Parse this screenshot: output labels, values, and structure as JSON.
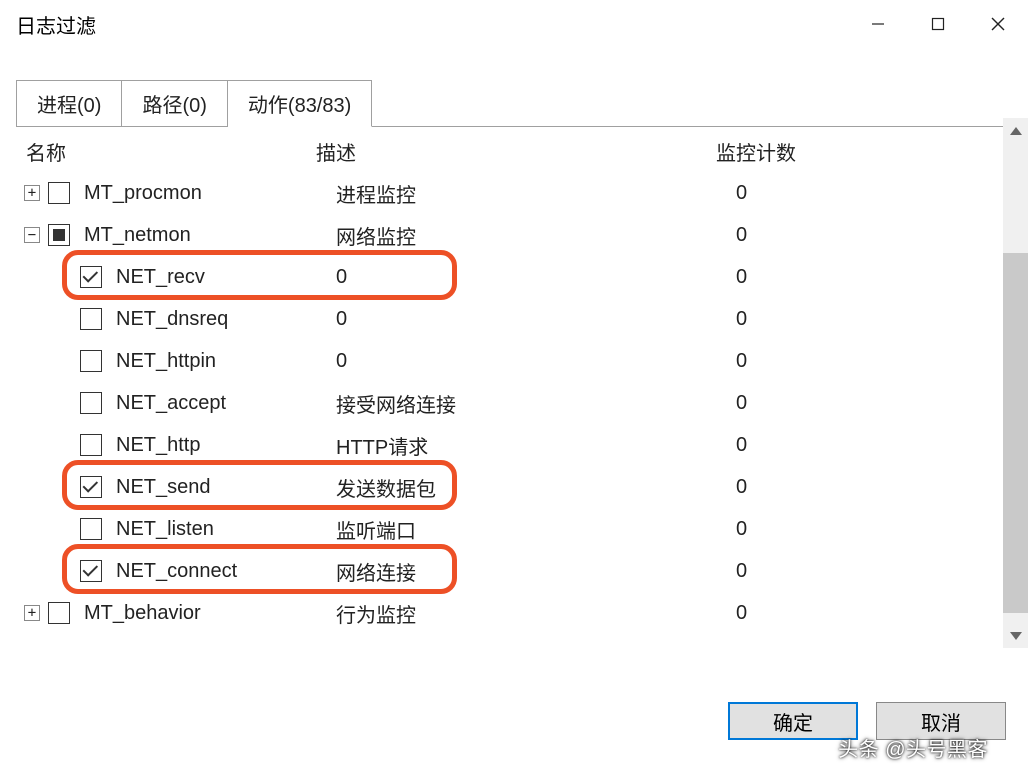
{
  "window": {
    "title": "日志过滤"
  },
  "tabs": [
    {
      "label": "进程(0)"
    },
    {
      "label": "路径(0)"
    },
    {
      "label": "动作(83/83)"
    }
  ],
  "columns": {
    "name": "名称",
    "desc": "描述",
    "count": "监控计数"
  },
  "tree": [
    {
      "indent": 0,
      "expand": "+",
      "check": "none",
      "name": "MT_procmon",
      "desc": "进程监控",
      "count": "0"
    },
    {
      "indent": 0,
      "expand": "-",
      "check": "partial",
      "name": "MT_netmon",
      "desc": "网络监控",
      "count": "0"
    },
    {
      "indent": 1,
      "expand": "",
      "check": "checked",
      "name": "NET_recv",
      "desc": "0",
      "count": "0",
      "highlight": true
    },
    {
      "indent": 1,
      "expand": "",
      "check": "none",
      "name": "NET_dnsreq",
      "desc": "0",
      "count": "0"
    },
    {
      "indent": 1,
      "expand": "",
      "check": "none",
      "name": "NET_httpin",
      "desc": "0",
      "count": "0"
    },
    {
      "indent": 1,
      "expand": "",
      "check": "none",
      "name": "NET_accept",
      "desc": "接受网络连接",
      "count": "0"
    },
    {
      "indent": 1,
      "expand": "",
      "check": "none",
      "name": "NET_http",
      "desc": "HTTP请求",
      "count": "0"
    },
    {
      "indent": 1,
      "expand": "",
      "check": "checked",
      "name": "NET_send",
      "desc": "发送数据包",
      "count": "0",
      "highlight": true
    },
    {
      "indent": 1,
      "expand": "",
      "check": "none",
      "name": "NET_listen",
      "desc": "监听端口",
      "count": "0"
    },
    {
      "indent": 1,
      "expand": "",
      "check": "checked",
      "name": "NET_connect",
      "desc": "网络连接",
      "count": "0",
      "highlight": true
    },
    {
      "indent": 0,
      "expand": "+",
      "check": "none",
      "name": "MT_behavior",
      "desc": "行为监控",
      "count": "0"
    }
  ],
  "buttons": {
    "ok": "确定",
    "cancel": "取消"
  },
  "watermark": "头条 @头号黑客"
}
